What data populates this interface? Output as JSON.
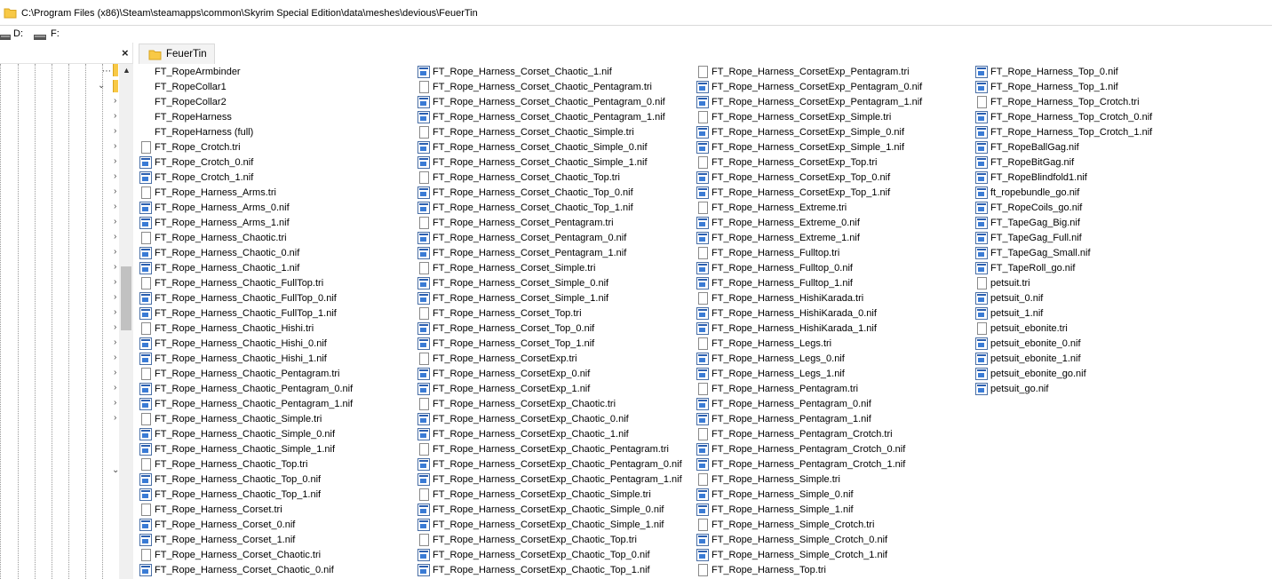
{
  "path_bar": {
    "path": "C:\\Program Files (x86)\\Steam\\steamapps\\common\\Skyrim Special Edition\\data\\meshes\\devious\\FeuerTin",
    "icon": "folder-icon"
  },
  "drives": [
    {
      "label": "D:",
      "icon": "drive-icon"
    },
    {
      "label": "F:",
      "icon": "drive-icon"
    }
  ],
  "tree": {
    "close_label": "×",
    "expand_markers": [
      "›",
      "⌄"
    ]
  },
  "tab": {
    "label": "FeuerTin",
    "icon": "folder-icon"
  },
  "files": {
    "columns": [
      [
        {
          "name": "FT_RopeArmbinder",
          "icon": "blank"
        },
        {
          "name": "FT_RopeCollar1",
          "icon": "blank"
        },
        {
          "name": "FT_RopeCollar2",
          "icon": "blank"
        },
        {
          "name": "FT_RopeHarness",
          "icon": "blank"
        },
        {
          "name": "FT_RopeHarness (full)",
          "icon": "blank"
        },
        {
          "name": "FT_Rope_Crotch.tri",
          "icon": "tri"
        },
        {
          "name": "FT_Rope_Crotch_0.nif",
          "icon": "nif"
        },
        {
          "name": "FT_Rope_Crotch_1.nif",
          "icon": "nif"
        },
        {
          "name": "FT_Rope_Harness_Arms.tri",
          "icon": "tri"
        },
        {
          "name": "FT_Rope_Harness_Arms_0.nif",
          "icon": "nif"
        },
        {
          "name": "FT_Rope_Harness_Arms_1.nif",
          "icon": "nif"
        },
        {
          "name": "FT_Rope_Harness_Chaotic.tri",
          "icon": "tri"
        },
        {
          "name": "FT_Rope_Harness_Chaotic_0.nif",
          "icon": "nif"
        },
        {
          "name": "FT_Rope_Harness_Chaotic_1.nif",
          "icon": "nif"
        },
        {
          "name": "FT_Rope_Harness_Chaotic_FullTop.tri",
          "icon": "tri"
        },
        {
          "name": "FT_Rope_Harness_Chaotic_FullTop_0.nif",
          "icon": "nif"
        },
        {
          "name": "FT_Rope_Harness_Chaotic_FullTop_1.nif",
          "icon": "nif"
        },
        {
          "name": "FT_Rope_Harness_Chaotic_Hishi.tri",
          "icon": "tri"
        },
        {
          "name": "FT_Rope_Harness_Chaotic_Hishi_0.nif",
          "icon": "nif"
        },
        {
          "name": "FT_Rope_Harness_Chaotic_Hishi_1.nif",
          "icon": "nif"
        },
        {
          "name": "FT_Rope_Harness_Chaotic_Pentagram.tri",
          "icon": "tri"
        },
        {
          "name": "FT_Rope_Harness_Chaotic_Pentagram_0.nif",
          "icon": "nif"
        },
        {
          "name": "FT_Rope_Harness_Chaotic_Pentagram_1.nif",
          "icon": "nif"
        },
        {
          "name": "FT_Rope_Harness_Chaotic_Simple.tri",
          "icon": "tri"
        },
        {
          "name": "FT_Rope_Harness_Chaotic_Simple_0.nif",
          "icon": "nif"
        },
        {
          "name": "FT_Rope_Harness_Chaotic_Simple_1.nif",
          "icon": "nif"
        },
        {
          "name": "FT_Rope_Harness_Chaotic_Top.tri",
          "icon": "tri"
        },
        {
          "name": "FT_Rope_Harness_Chaotic_Top_0.nif",
          "icon": "nif"
        },
        {
          "name": "FT_Rope_Harness_Chaotic_Top_1.nif",
          "icon": "nif"
        },
        {
          "name": "FT_Rope_Harness_Corset.tri",
          "icon": "tri"
        },
        {
          "name": "FT_Rope_Harness_Corset_0.nif",
          "icon": "nif"
        },
        {
          "name": "FT_Rope_Harness_Corset_1.nif",
          "icon": "nif"
        },
        {
          "name": "FT_Rope_Harness_Corset_Chaotic.tri",
          "icon": "tri"
        },
        {
          "name": "FT_Rope_Harness_Corset_Chaotic_0.nif",
          "icon": "nif"
        }
      ],
      [
        {
          "name": "FT_Rope_Harness_Corset_Chaotic_1.nif",
          "icon": "nif"
        },
        {
          "name": "FT_Rope_Harness_Corset_Chaotic_Pentagram.tri",
          "icon": "tri"
        },
        {
          "name": "FT_Rope_Harness_Corset_Chaotic_Pentagram_0.nif",
          "icon": "nif"
        },
        {
          "name": "FT_Rope_Harness_Corset_Chaotic_Pentagram_1.nif",
          "icon": "nif"
        },
        {
          "name": "FT_Rope_Harness_Corset_Chaotic_Simple.tri",
          "icon": "tri"
        },
        {
          "name": "FT_Rope_Harness_Corset_Chaotic_Simple_0.nif",
          "icon": "nif"
        },
        {
          "name": "FT_Rope_Harness_Corset_Chaotic_Simple_1.nif",
          "icon": "nif"
        },
        {
          "name": "FT_Rope_Harness_Corset_Chaotic_Top.tri",
          "icon": "tri"
        },
        {
          "name": "FT_Rope_Harness_Corset_Chaotic_Top_0.nif",
          "icon": "nif"
        },
        {
          "name": "FT_Rope_Harness_Corset_Chaotic_Top_1.nif",
          "icon": "nif"
        },
        {
          "name": "FT_Rope_Harness_Corset_Pentagram.tri",
          "icon": "tri"
        },
        {
          "name": "FT_Rope_Harness_Corset_Pentagram_0.nif",
          "icon": "nif"
        },
        {
          "name": "FT_Rope_Harness_Corset_Pentagram_1.nif",
          "icon": "nif"
        },
        {
          "name": "FT_Rope_Harness_Corset_Simple.tri",
          "icon": "tri"
        },
        {
          "name": "FT_Rope_Harness_Corset_Simple_0.nif",
          "icon": "nif"
        },
        {
          "name": "FT_Rope_Harness_Corset_Simple_1.nif",
          "icon": "nif"
        },
        {
          "name": "FT_Rope_Harness_Corset_Top.tri",
          "icon": "tri"
        },
        {
          "name": "FT_Rope_Harness_Corset_Top_0.nif",
          "icon": "nif"
        },
        {
          "name": "FT_Rope_Harness_Corset_Top_1.nif",
          "icon": "nif"
        },
        {
          "name": "FT_Rope_Harness_CorsetExp.tri",
          "icon": "tri"
        },
        {
          "name": "FT_Rope_Harness_CorsetExp_0.nif",
          "icon": "nif"
        },
        {
          "name": "FT_Rope_Harness_CorsetExp_1.nif",
          "icon": "nif"
        },
        {
          "name": "FT_Rope_Harness_CorsetExp_Chaotic.tri",
          "icon": "tri"
        },
        {
          "name": "FT_Rope_Harness_CorsetExp_Chaotic_0.nif",
          "icon": "nif"
        },
        {
          "name": "FT_Rope_Harness_CorsetExp_Chaotic_1.nif",
          "icon": "nif"
        },
        {
          "name": "FT_Rope_Harness_CorsetExp_Chaotic_Pentagram.tri",
          "icon": "tri"
        },
        {
          "name": "FT_Rope_Harness_CorsetExp_Chaotic_Pentagram_0.nif",
          "icon": "nif"
        },
        {
          "name": "FT_Rope_Harness_CorsetExp_Chaotic_Pentagram_1.nif",
          "icon": "nif"
        },
        {
          "name": "FT_Rope_Harness_CorsetExp_Chaotic_Simple.tri",
          "icon": "tri"
        },
        {
          "name": "FT_Rope_Harness_CorsetExp_Chaotic_Simple_0.nif",
          "icon": "nif"
        },
        {
          "name": "FT_Rope_Harness_CorsetExp_Chaotic_Simple_1.nif",
          "icon": "nif"
        },
        {
          "name": "FT_Rope_Harness_CorsetExp_Chaotic_Top.tri",
          "icon": "tri"
        },
        {
          "name": "FT_Rope_Harness_CorsetExp_Chaotic_Top_0.nif",
          "icon": "nif"
        },
        {
          "name": "FT_Rope_Harness_CorsetExp_Chaotic_Top_1.nif",
          "icon": "nif"
        }
      ],
      [
        {
          "name": "FT_Rope_Harness_CorsetExp_Pentagram.tri",
          "icon": "tri"
        },
        {
          "name": "FT_Rope_Harness_CorsetExp_Pentagram_0.nif",
          "icon": "nif"
        },
        {
          "name": "FT_Rope_Harness_CorsetExp_Pentagram_1.nif",
          "icon": "nif"
        },
        {
          "name": "FT_Rope_Harness_CorsetExp_Simple.tri",
          "icon": "tri"
        },
        {
          "name": "FT_Rope_Harness_CorsetExp_Simple_0.nif",
          "icon": "nif"
        },
        {
          "name": "FT_Rope_Harness_CorsetExp_Simple_1.nif",
          "icon": "nif"
        },
        {
          "name": "FT_Rope_Harness_CorsetExp_Top.tri",
          "icon": "tri"
        },
        {
          "name": "FT_Rope_Harness_CorsetExp_Top_0.nif",
          "icon": "nif"
        },
        {
          "name": "FT_Rope_Harness_CorsetExp_Top_1.nif",
          "icon": "nif"
        },
        {
          "name": "FT_Rope_Harness_Extreme.tri",
          "icon": "tri"
        },
        {
          "name": "FT_Rope_Harness_Extreme_0.nif",
          "icon": "nif"
        },
        {
          "name": "FT_Rope_Harness_Extreme_1.nif",
          "icon": "nif"
        },
        {
          "name": "FT_Rope_Harness_Fulltop.tri",
          "icon": "tri"
        },
        {
          "name": "FT_Rope_Harness_Fulltop_0.nif",
          "icon": "nif"
        },
        {
          "name": "FT_Rope_Harness_Fulltop_1.nif",
          "icon": "nif"
        },
        {
          "name": "FT_Rope_Harness_HishiKarada.tri",
          "icon": "tri"
        },
        {
          "name": "FT_Rope_Harness_HishiKarada_0.nif",
          "icon": "nif"
        },
        {
          "name": "FT_Rope_Harness_HishiKarada_1.nif",
          "icon": "nif"
        },
        {
          "name": "FT_Rope_Harness_Legs.tri",
          "icon": "tri"
        },
        {
          "name": "FT_Rope_Harness_Legs_0.nif",
          "icon": "nif"
        },
        {
          "name": "FT_Rope_Harness_Legs_1.nif",
          "icon": "nif"
        },
        {
          "name": "FT_Rope_Harness_Pentagram.tri",
          "icon": "tri"
        },
        {
          "name": "FT_Rope_Harness_Pentagram_0.nif",
          "icon": "nif"
        },
        {
          "name": "FT_Rope_Harness_Pentagram_1.nif",
          "icon": "nif"
        },
        {
          "name": "FT_Rope_Harness_Pentagram_Crotch.tri",
          "icon": "tri"
        },
        {
          "name": "FT_Rope_Harness_Pentagram_Crotch_0.nif",
          "icon": "nif"
        },
        {
          "name": "FT_Rope_Harness_Pentagram_Crotch_1.nif",
          "icon": "nif"
        },
        {
          "name": "FT_Rope_Harness_Simple.tri",
          "icon": "tri"
        },
        {
          "name": "FT_Rope_Harness_Simple_0.nif",
          "icon": "nif"
        },
        {
          "name": "FT_Rope_Harness_Simple_1.nif",
          "icon": "nif"
        },
        {
          "name": "FT_Rope_Harness_Simple_Crotch.tri",
          "icon": "tri"
        },
        {
          "name": "FT_Rope_Harness_Simple_Crotch_0.nif",
          "icon": "nif"
        },
        {
          "name": "FT_Rope_Harness_Simple_Crotch_1.nif",
          "icon": "nif"
        },
        {
          "name": "FT_Rope_Harness_Top.tri",
          "icon": "tri"
        }
      ],
      [
        {
          "name": "FT_Rope_Harness_Top_0.nif",
          "icon": "nif"
        },
        {
          "name": "FT_Rope_Harness_Top_1.nif",
          "icon": "nif"
        },
        {
          "name": "FT_Rope_Harness_Top_Crotch.tri",
          "icon": "tri"
        },
        {
          "name": "FT_Rope_Harness_Top_Crotch_0.nif",
          "icon": "nif"
        },
        {
          "name": "FT_Rope_Harness_Top_Crotch_1.nif",
          "icon": "nif"
        },
        {
          "name": "FT_RopeBallGag.nif",
          "icon": "nif"
        },
        {
          "name": "FT_RopeBitGag.nif",
          "icon": "nif"
        },
        {
          "name": "FT_RopeBlindfold1.nif",
          "icon": "nif"
        },
        {
          "name": "ft_ropebundle_go.nif",
          "icon": "nif"
        },
        {
          "name": "FT_RopeCoils_go.nif",
          "icon": "nif"
        },
        {
          "name": "FT_TapeGag_Big.nif",
          "icon": "nif"
        },
        {
          "name": "FT_TapeGag_Full.nif",
          "icon": "nif"
        },
        {
          "name": "FT_TapeGag_Small.nif",
          "icon": "nif"
        },
        {
          "name": "FT_TapeRoll_go.nif",
          "icon": "nif"
        },
        {
          "name": "petsuit.tri",
          "icon": "tri"
        },
        {
          "name": "petsuit_0.nif",
          "icon": "nif"
        },
        {
          "name": "petsuit_1.nif",
          "icon": "nif"
        },
        {
          "name": "petsuit_ebonite.tri",
          "icon": "tri"
        },
        {
          "name": "petsuit_ebonite_0.nif",
          "icon": "nif"
        },
        {
          "name": "petsuit_ebonite_1.nif",
          "icon": "nif"
        },
        {
          "name": "petsuit_ebonite_go.nif",
          "icon": "nif"
        },
        {
          "name": "petsuit_go.nif",
          "icon": "nif"
        }
      ]
    ]
  },
  "colors": {
    "folder": "#f8c946",
    "nif_icon": "#2b5fb0",
    "tab_bg": "#f3f3f3"
  }
}
